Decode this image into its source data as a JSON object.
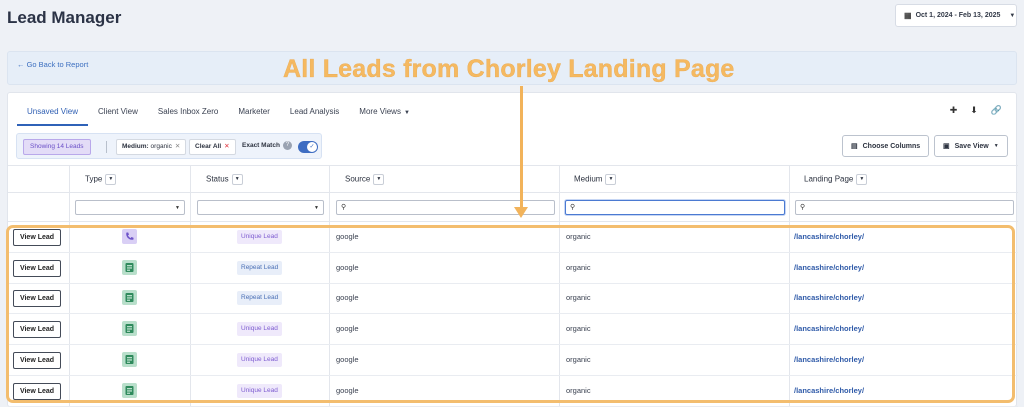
{
  "app": {
    "title": "Lead Manager"
  },
  "date_range": {
    "label": "Oct 1, 2024 - Feb 13, 2025"
  },
  "back_link": {
    "label": "← Go Back to Report"
  },
  "annotation": {
    "text": "All Leads from Chorley Landing Page"
  },
  "tabs": [
    {
      "label": "Unsaved View"
    },
    {
      "label": "Client View"
    },
    {
      "label": "Sales Inbox Zero"
    },
    {
      "label": "Marketer"
    },
    {
      "label": "Lead Analysis"
    },
    {
      "label": "More Views"
    }
  ],
  "filters": {
    "showing": "Showing 14 Leads",
    "medium_key": "Medium:",
    "medium_value": "organic",
    "clear_all": "Clear All",
    "exact_match": "Exact Match",
    "help": "?"
  },
  "buttons": {
    "choose_columns": "Choose Columns",
    "save_view": "Save View"
  },
  "columns": {
    "type": "Type",
    "status": "Status",
    "source": "Source",
    "medium": "Medium",
    "landing_page": "Landing Page"
  },
  "rows": [
    {
      "action": "View Lead",
      "type_icon": "phone-icon",
      "status": "Unique Lead",
      "source": "google",
      "medium": "organic",
      "landing_page": "/lancashire/chorley/"
    },
    {
      "action": "View Lead",
      "type_icon": "form-icon",
      "status": "Repeat Lead",
      "source": "google",
      "medium": "organic",
      "landing_page": "/lancashire/chorley/"
    },
    {
      "action": "View Lead",
      "type_icon": "form-icon",
      "status": "Repeat Lead",
      "source": "google",
      "medium": "organic",
      "landing_page": "/lancashire/chorley/"
    },
    {
      "action": "View Lead",
      "type_icon": "form-icon",
      "status": "Unique Lead",
      "source": "google",
      "medium": "organic",
      "landing_page": "/lancashire/chorley/"
    },
    {
      "action": "View Lead",
      "type_icon": "form-icon",
      "status": "Unique Lead",
      "source": "google",
      "medium": "organic",
      "landing_page": "/lancashire/chorley/"
    },
    {
      "action": "View Lead",
      "type_icon": "form-icon",
      "status": "Unique Lead",
      "source": "google",
      "medium": "organic",
      "landing_page": "/lancashire/chorley/"
    }
  ],
  "colors": {
    "accent": "#2f62b8",
    "annotation": "#f5b961",
    "unique_badge": "#7d5bd0",
    "repeat_badge": "#4a6fb5"
  }
}
